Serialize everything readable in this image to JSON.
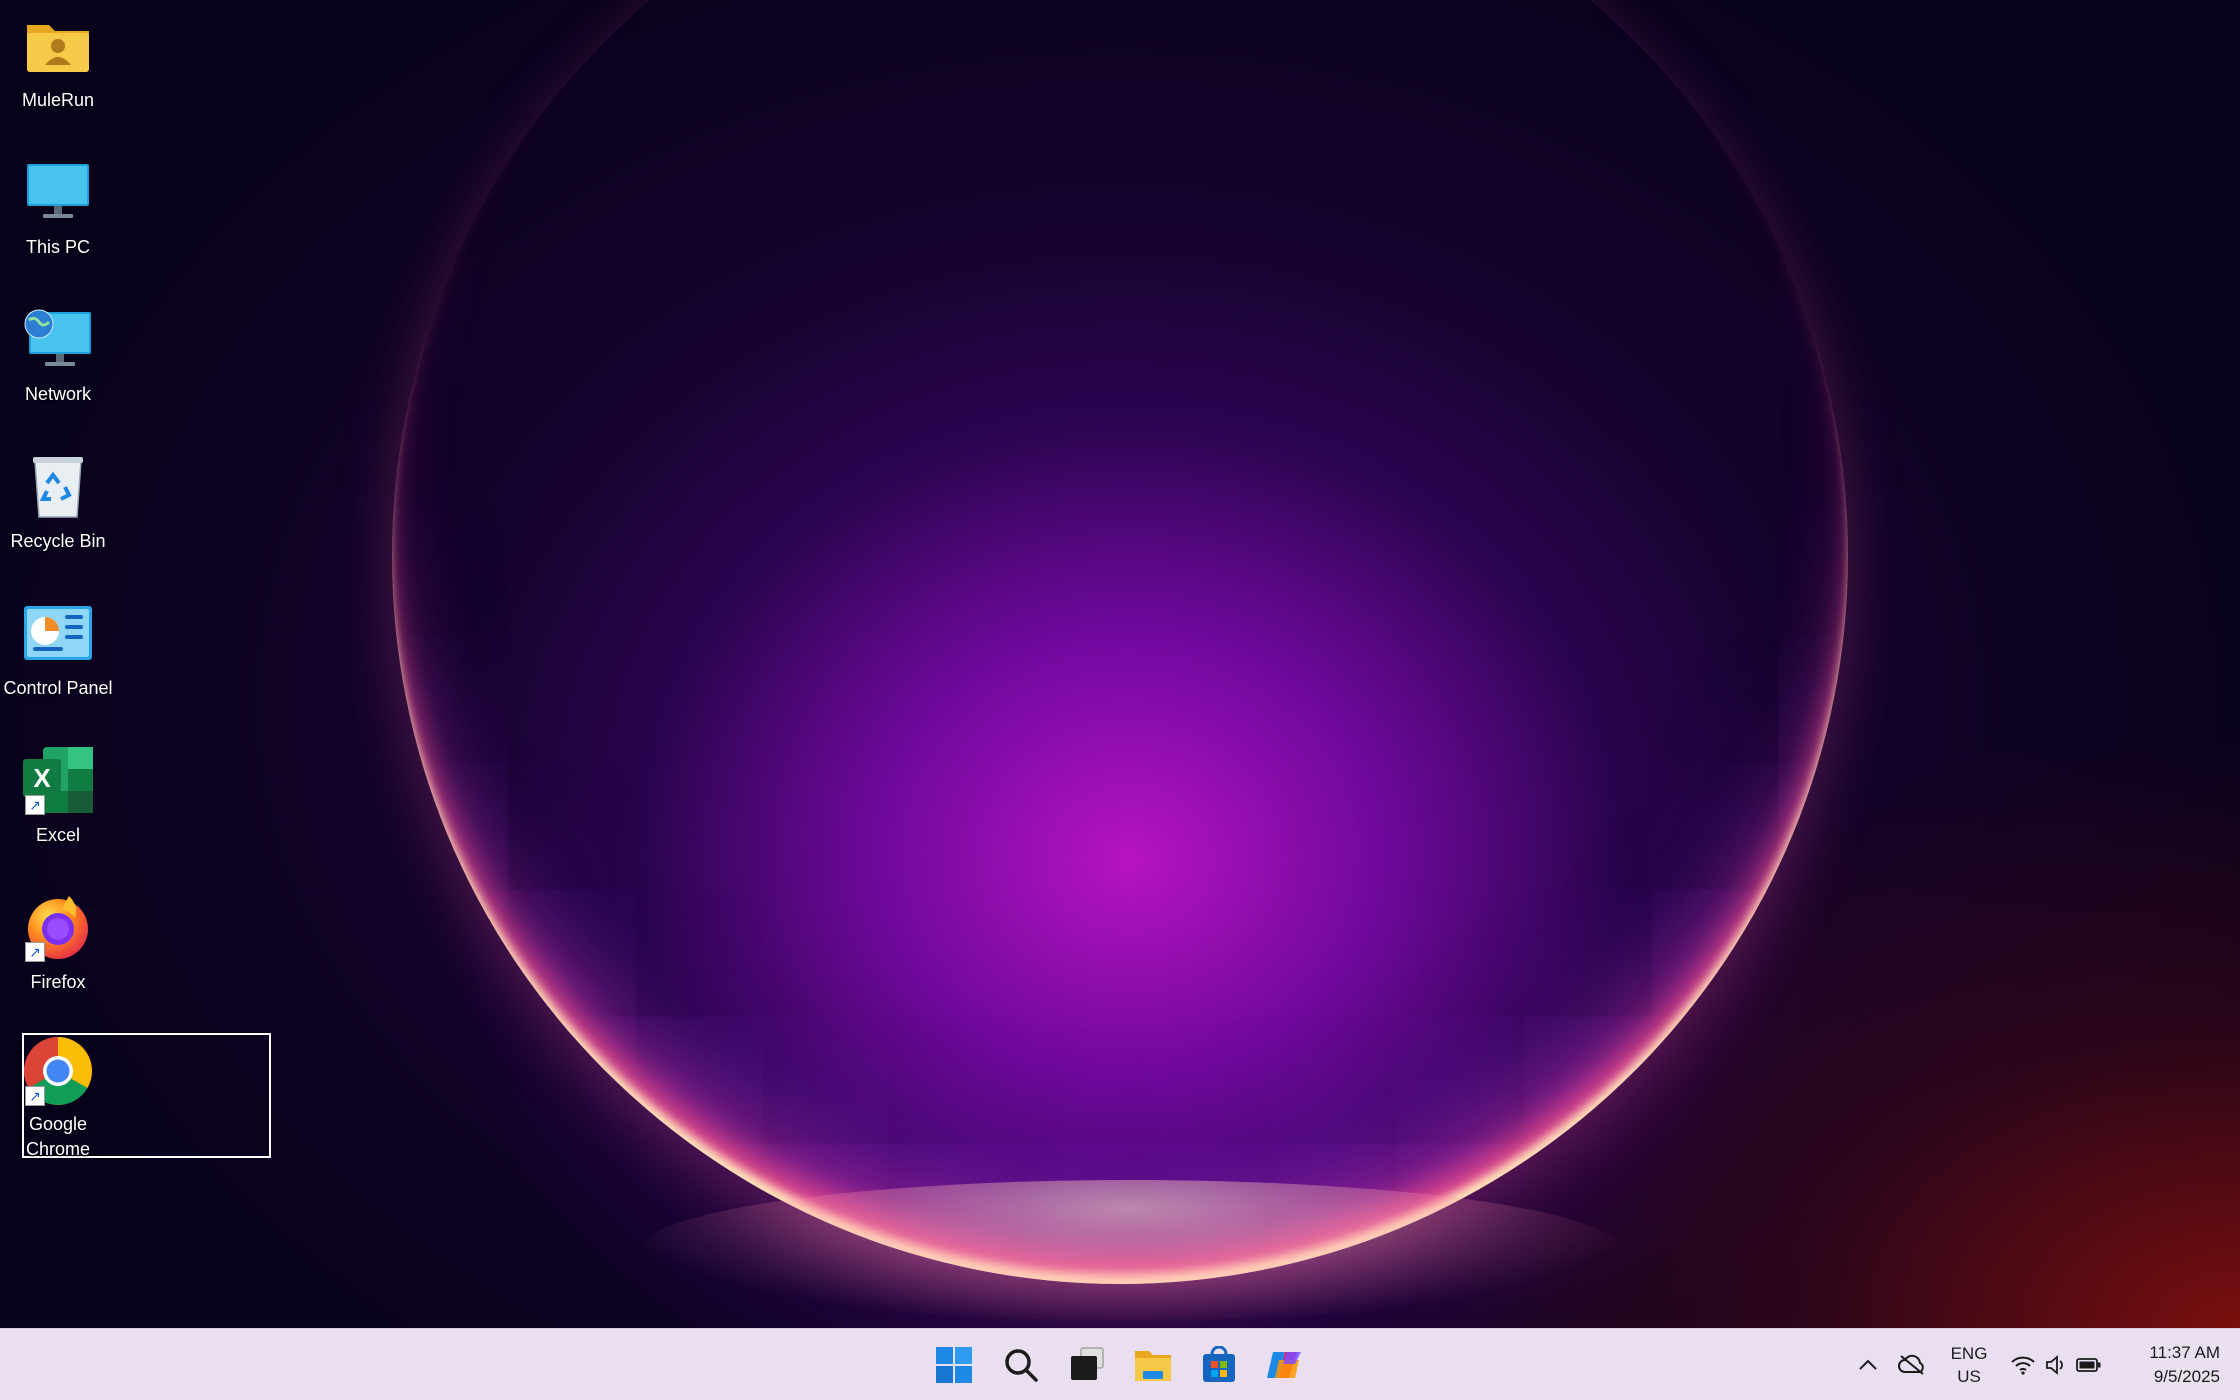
{
  "desktop": {
    "icons": [
      {
        "label": "MuleRun",
        "icon": "user-folder-icon"
      },
      {
        "label": "This PC",
        "icon": "monitor-icon"
      },
      {
        "label": "Network",
        "icon": "network-icon"
      },
      {
        "label": "Recycle Bin",
        "icon": "recycle-bin-icon"
      },
      {
        "label": "Control Panel",
        "icon": "control-panel-icon"
      },
      {
        "label": "Excel",
        "icon": "excel-icon"
      },
      {
        "label": "Firefox",
        "icon": "firefox-icon"
      },
      {
        "label": "Google Chrome",
        "icon": "chrome-icon"
      }
    ]
  },
  "taskbar": {
    "apps": [
      {
        "name": "Start",
        "icon": "windows-start-icon"
      },
      {
        "name": "Search",
        "icon": "search-icon"
      },
      {
        "name": "Task View",
        "icon": "task-view-icon"
      },
      {
        "name": "File Explorer",
        "icon": "file-explorer-icon"
      },
      {
        "name": "Microsoft Store",
        "icon": "store-icon"
      },
      {
        "name": "Copilot",
        "icon": "copilot-icon"
      }
    ],
    "tray": {
      "language_line1": "ENG",
      "language_line2": "US",
      "time": "11:37 AM",
      "date": "9/5/2025"
    }
  },
  "colors": {
    "taskbar_bg": "#eadff0",
    "accent_blue": "#0078d4"
  }
}
